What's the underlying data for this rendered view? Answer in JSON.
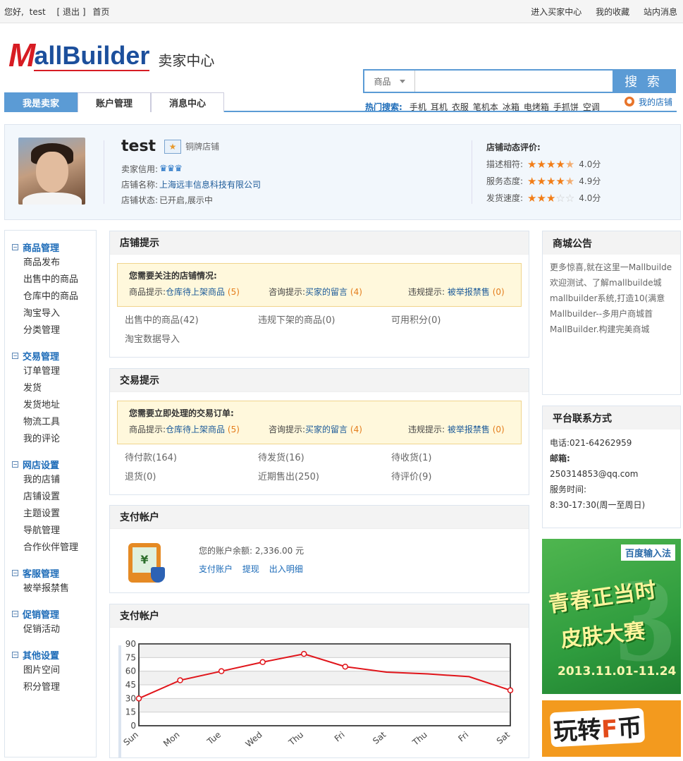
{
  "topbar": {
    "greeting": "您好,",
    "username": "test",
    "logout": "[ 退出 ]",
    "home": "首页",
    "links": [
      "进入买家中心",
      "我的收藏",
      "站内消息"
    ]
  },
  "header": {
    "logo_m": "M",
    "logo_rest": "allBuilder",
    "subtitle": "卖家中心",
    "search_category": "商品",
    "search_placeholder": "",
    "search_button": "搜 索",
    "hot_label": "热门搜索:",
    "hot_terms": [
      "手机",
      "耳机",
      "衣服",
      "笔机本",
      "冰箱",
      "电烤箱",
      "手抓饼",
      "空调"
    ]
  },
  "nav": {
    "tabs": [
      "我是卖家",
      "账户管理",
      "消息中心"
    ],
    "mystore": "我的店铺"
  },
  "profile": {
    "name": "test",
    "level": "铜牌店铺",
    "credit_label": "卖家信用:",
    "credit_icons": "♛♛♛",
    "store_label": "店铺名称:",
    "store_name": "上海远丰信息科技有限公司",
    "status_label": "店铺状态:",
    "status": "已开启,展示中",
    "rating_title": "店铺动态评价:",
    "ratings": [
      {
        "label": "描述相符:",
        "score": "4.0分",
        "stars": 4.5
      },
      {
        "label": "服务态度:",
        "score": "4.9分",
        "stars": 4.5
      },
      {
        "label": "发货速度:",
        "score": "4.0分",
        "stars": 3
      }
    ]
  },
  "sidebar": {
    "groups": [
      {
        "title": "商品管理",
        "items": [
          "商品发布",
          "出售中的商品",
          "仓库中的商品",
          "淘宝导入",
          "分类管理"
        ]
      },
      {
        "title": "交易管理",
        "items": [
          "订单管理",
          "发货",
          "发货地址",
          "物流工具",
          "我的评论"
        ]
      },
      {
        "title": "网店设置",
        "items": [
          "我的店铺",
          "店铺设置",
          "主题设置",
          "导航管理",
          "合作伙伴管理"
        ]
      },
      {
        "title": "客服管理",
        "items": [
          "被举报禁售"
        ]
      },
      {
        "title": "促销管理",
        "items": [
          "促销活动"
        ]
      },
      {
        "title": "其他设置",
        "items": [
          "图片空间",
          "积分管理"
        ]
      }
    ]
  },
  "store_tips": {
    "title": "店铺提示",
    "notice_title": "您需要关注的店铺情况:",
    "tips": [
      {
        "label": "商品提示:",
        "link": "仓库待上架商品",
        "count": "(5)"
      },
      {
        "label": "咨询提示:",
        "link": "买家的留言",
        "count": "(4)"
      },
      {
        "label": "违规提示:",
        "link": "被举报禁售",
        "count": "(0)"
      }
    ],
    "stats": [
      "出售中的商品(42)",
      "违规下架的商品(0)",
      "可用积分(0)",
      "淘宝数据导入"
    ]
  },
  "trade_tips": {
    "title": "交易提示",
    "notice_title": "您需要立即处理的交易订单:",
    "tips": [
      {
        "label": "商品提示:",
        "link": "仓库待上架商品",
        "count": "(5)"
      },
      {
        "label": "咨询提示:",
        "link": "买家的留言",
        "count": "(4)"
      },
      {
        "label": "违规提示:",
        "link": "被举报禁售",
        "count": "(0)"
      }
    ],
    "stats": [
      "待付款(164)",
      "待发货(16)",
      "待收货(1)",
      "退货(0)",
      "近期售出(250)",
      "待评价(9)"
    ]
  },
  "payment": {
    "title": "支付帐户",
    "balance_label": "您的账户余额:",
    "balance": "2,336.00 元",
    "links": [
      "支付账户",
      "提现",
      "出入明细"
    ]
  },
  "chart_panel": {
    "title": "支付帐户"
  },
  "chart_data": {
    "type": "line",
    "categories": [
      "Sun",
      "Mon",
      "Tue",
      "Wed",
      "Thu",
      "Fri",
      "Sat",
      "Thu",
      "Fri",
      "Sat"
    ],
    "yticks": [
      0,
      15,
      30,
      45,
      60,
      75,
      90
    ],
    "ylim": [
      0,
      90
    ],
    "grid": true,
    "color": "#e0141a",
    "x": [
      0,
      1,
      2,
      3,
      4,
      5,
      6,
      7,
      8,
      9
    ],
    "values": [
      30,
      50,
      60,
      70,
      79,
      65,
      59,
      57,
      54,
      39
    ],
    "marked": [
      true,
      true,
      true,
      true,
      true,
      true,
      false,
      false,
      false,
      true
    ]
  },
  "announcements": {
    "title": "商城公告",
    "items": [
      "更多惊喜,就在这里一Mallbuilde",
      "欢迎测试、了解mallbuilde城",
      "mallbuilder系统,打造10(满意",
      "Mallbuilder--多用户商城首",
      "MallBuilder.构建完美商城"
    ]
  },
  "contact": {
    "title": "平台联系方式",
    "phone": "电话:021-64262959",
    "email_label": "邮箱:",
    "email": "250314853@qq.com",
    "hours_label": "服务时间:",
    "hours": "8:30-17:30(周一至周日)"
  },
  "ads": {
    "ad1_brand": "百度输入法",
    "ad1_line1": "青春正当时",
    "ad1_line2": "皮肤大赛",
    "ad1_date": "2013.11.01-11.24",
    "ad1_num": "3",
    "ad2_text_a": "玩转",
    "ad2_text_f": "F",
    "ad2_text_b": "币"
  }
}
